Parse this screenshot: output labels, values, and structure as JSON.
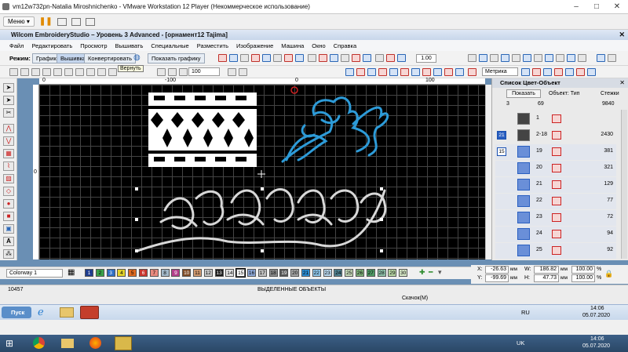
{
  "vm": {
    "title": "vm12w732pn-Natalia Miroshnichenko - VMware Workstation 12 Player (Некоммерческое использование)",
    "menu_label": "Меню",
    "window_controls": [
      "–",
      "□",
      "✕"
    ]
  },
  "app": {
    "title": "Wilcom EmbroideryStudio – Уровень 3 Advanced - [орнамент12    Tajima]",
    "menu": [
      "Файл",
      "Редактировать",
      "Просмотр",
      "Вышивать",
      "Специальные",
      "Разместить",
      "Изображение",
      "Машина",
      "Окно",
      "Справка"
    ],
    "mode_label": "Режим:",
    "mode_buttons": [
      "Графика",
      "Вышивка",
      "Конвертировать"
    ],
    "show_graphics_label": "Показать графику",
    "zoom_value": "1.00",
    "zoom_pct": "100",
    "units_value": "Метрика",
    "tooltip": "Вернуть"
  },
  "ruler": {
    "h_labels": [
      "0",
      "-100",
      "0",
      "100"
    ],
    "v_labels": [
      "0"
    ]
  },
  "panel": {
    "title": "Список Цвет-Объект",
    "show_btn": "Показать",
    "object_type_label": "Объект: Тип",
    "stitches_label": "Стежки",
    "header_counts": [
      "3",
      "69",
      "9840"
    ],
    "rows": [
      {
        "badge": "",
        "num": "1",
        "stitches": ""
      },
      {
        "badge": "21",
        "num": "2-18",
        "stitches": "2430"
      },
      {
        "badge": "15",
        "num": "19",
        "stitches": "381"
      },
      {
        "badge": "",
        "num": "20",
        "stitches": "321"
      },
      {
        "badge": "",
        "num": "21",
        "stitches": "129"
      },
      {
        "badge": "",
        "num": "22",
        "stitches": "77"
      },
      {
        "badge": "",
        "num": "23",
        "stitches": "72"
      },
      {
        "badge": "",
        "num": "24",
        "stitches": "94"
      },
      {
        "badge": "",
        "num": "25",
        "stitches": "92"
      }
    ]
  },
  "colorbar": {
    "colorway": "Colorway 1",
    "swatches": [
      {
        "n": "1",
        "c": "#1f3d8f"
      },
      {
        "n": "2",
        "c": "#3aa14a"
      },
      {
        "n": "3",
        "c": "#2f6fc5"
      },
      {
        "n": "4",
        "c": "#e3d22a"
      },
      {
        "n": "5",
        "c": "#e06a1f"
      },
      {
        "n": "6",
        "c": "#c9352d"
      },
      {
        "n": "7",
        "c": "#e88a7e"
      },
      {
        "n": "8",
        "c": "#a2b8c9"
      },
      {
        "n": "9",
        "c": "#b33f8b"
      },
      {
        "n": "10",
        "c": "#7e4a25"
      },
      {
        "n": "11",
        "c": "#d29a70"
      },
      {
        "n": "12",
        "c": "#c8c8c8"
      },
      {
        "n": "13",
        "c": "#1a1a1a"
      },
      {
        "n": "14",
        "c": "#e2e2e2"
      },
      {
        "n": "15",
        "c": "#ffffff"
      },
      {
        "n": "16",
        "c": "#8da8d8"
      },
      {
        "n": "17",
        "c": "#bfbfbf"
      },
      {
        "n": "18",
        "c": "#8a8a8a"
      },
      {
        "n": "19",
        "c": "#565656"
      },
      {
        "n": "20",
        "c": "#a2a2a2"
      },
      {
        "n": "21",
        "c": "#2a8bd1"
      },
      {
        "n": "22",
        "c": "#8cc4e8"
      },
      {
        "n": "23",
        "c": "#b8d6ec"
      },
      {
        "n": "24",
        "c": "#4e7f8f"
      },
      {
        "n": "25",
        "c": "#c5d9b8"
      },
      {
        "n": "26",
        "c": "#7eb07a"
      },
      {
        "n": "27",
        "c": "#4f9a66"
      },
      {
        "n": "28",
        "c": "#8fc1a9"
      },
      {
        "n": "29",
        "c": "#b8d7a4"
      },
      {
        "n": "30",
        "c": "#d6e7c6"
      }
    ]
  },
  "coords": {
    "x_label": "X:",
    "x_value": "-26.63",
    "x_unit": "мм",
    "y_label": "Y:",
    "y_value": "-99.69",
    "y_unit": "мм",
    "w_label": "W:",
    "w_value": "186.82",
    "w_unit": "мм",
    "h_label": "H:",
    "h_value": "47.73",
    "h_unit": "мм",
    "sx_value": "100.00",
    "sy_value": "100.00",
    "pct": "%"
  },
  "status": {
    "stitch_count": "10457",
    "selection": "ВЫДЕЛЕННЫЕ ОБЪЕКТЫ",
    "hint": "Скачок(M)"
  },
  "guest_taskbar": {
    "start": "Пуск",
    "lang": "RU",
    "time": "14:06",
    "date": "05.07.2020"
  },
  "host_taskbar": {
    "lang": "UK",
    "time": "14:06",
    "date": "05.07.2020"
  }
}
